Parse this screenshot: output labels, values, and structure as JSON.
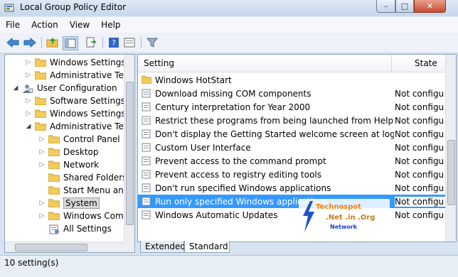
{
  "window": {
    "title": "Local Group Policy Editor",
    "controls": {
      "minimize": "–",
      "maximize": "□",
      "close": "✕"
    }
  },
  "menu": [
    "File",
    "Action",
    "View",
    "Help"
  ],
  "toolbar": {
    "buttons": [
      "back-icon",
      "forward-icon",
      "up-folder-icon",
      "show-hide-tree-icon",
      "export-list-icon",
      "help-icon",
      "properties-icon",
      "filter-icon"
    ]
  },
  "tree": [
    {
      "label": "Windows Settings",
      "arrow": "▷",
      "level": 2
    },
    {
      "label": "Administrative Tem",
      "arrow": "▷",
      "level": 2
    },
    {
      "label": "User Configuration",
      "arrow": "◢",
      "level": 1
    },
    {
      "label": "Software Settings",
      "arrow": "▷",
      "level": 2
    },
    {
      "label": "Windows Settings",
      "arrow": "▷",
      "level": 2
    },
    {
      "label": "Administrative Tem",
      "arrow": "◢",
      "level": 2
    },
    {
      "label": "Control Panel",
      "arrow": "▷",
      "level": 3
    },
    {
      "label": "Desktop",
      "arrow": "▷",
      "level": 3
    },
    {
      "label": "Network",
      "arrow": "▷",
      "level": 3
    },
    {
      "label": "Shared Folders",
      "arrow": "",
      "level": 3
    },
    {
      "label": "Start Menu and",
      "arrow": "",
      "level": 3
    },
    {
      "label": "System",
      "arrow": "▷",
      "level": 3
    },
    {
      "label": "Windows Comp",
      "arrow": "▷",
      "level": 3
    },
    {
      "label": "All Settings",
      "arrow": "",
      "level": 3
    }
  ],
  "list": {
    "headers": {
      "setting": "Setting",
      "state": "State"
    },
    "rows": [
      {
        "name": "Windows HotStart",
        "state": "",
        "type": "folder"
      },
      {
        "name": "Download missing COM components",
        "state": "Not configu",
        "type": "policy"
      },
      {
        "name": "Century interpretation for Year 2000",
        "state": "Not configu",
        "type": "policy"
      },
      {
        "name": "Restrict these programs from being launched from Help",
        "state": "Not configu",
        "type": "policy"
      },
      {
        "name": "Don't display the Getting Started welcome screen at logon",
        "state": "Not configu",
        "type": "policy"
      },
      {
        "name": "Custom User Interface",
        "state": "Not configu",
        "type": "policy"
      },
      {
        "name": "Prevent access to the command prompt",
        "state": "Not configu",
        "type": "policy"
      },
      {
        "name": "Prevent access to registry editing tools",
        "state": "Not configu",
        "type": "policy"
      },
      {
        "name": "Don't run specified Windows applications",
        "state": "Not configu",
        "type": "policy"
      },
      {
        "name": "Run only specified Windows applications",
        "state": "Not configu",
        "type": "policy",
        "selected": true
      },
      {
        "name": "Windows Automatic Updates",
        "state": "Not configu",
        "type": "policy"
      }
    ]
  },
  "tabs": [
    "Extended",
    "Standard"
  ],
  "status": "10 setting(s)",
  "watermark": {
    "line1": "Technospot",
    "line2": ".Net .in .Org",
    "line3": "Network"
  }
}
